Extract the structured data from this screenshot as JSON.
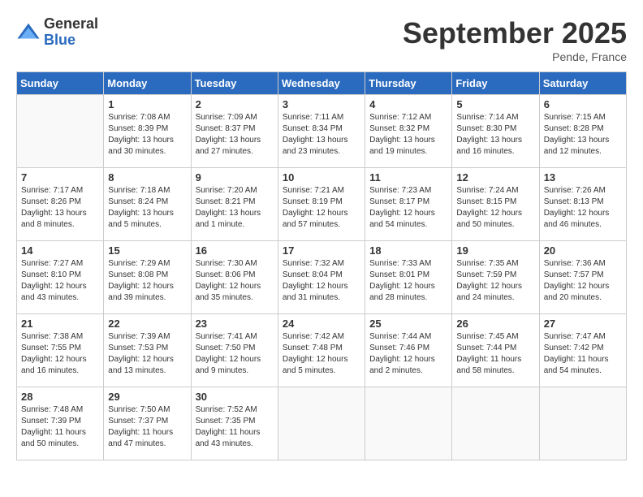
{
  "logo": {
    "general": "General",
    "blue": "Blue"
  },
  "title": "September 2025",
  "location": "Pende, France",
  "days_of_week": [
    "Sunday",
    "Monday",
    "Tuesday",
    "Wednesday",
    "Thursday",
    "Friday",
    "Saturday"
  ],
  "weeks": [
    [
      {
        "day": "",
        "info": ""
      },
      {
        "day": "1",
        "info": "Sunrise: 7:08 AM\nSunset: 8:39 PM\nDaylight: 13 hours\nand 30 minutes."
      },
      {
        "day": "2",
        "info": "Sunrise: 7:09 AM\nSunset: 8:37 PM\nDaylight: 13 hours\nand 27 minutes."
      },
      {
        "day": "3",
        "info": "Sunrise: 7:11 AM\nSunset: 8:34 PM\nDaylight: 13 hours\nand 23 minutes."
      },
      {
        "day": "4",
        "info": "Sunrise: 7:12 AM\nSunset: 8:32 PM\nDaylight: 13 hours\nand 19 minutes."
      },
      {
        "day": "5",
        "info": "Sunrise: 7:14 AM\nSunset: 8:30 PM\nDaylight: 13 hours\nand 16 minutes."
      },
      {
        "day": "6",
        "info": "Sunrise: 7:15 AM\nSunset: 8:28 PM\nDaylight: 13 hours\nand 12 minutes."
      }
    ],
    [
      {
        "day": "7",
        "info": "Sunrise: 7:17 AM\nSunset: 8:26 PM\nDaylight: 13 hours\nand 8 minutes."
      },
      {
        "day": "8",
        "info": "Sunrise: 7:18 AM\nSunset: 8:24 PM\nDaylight: 13 hours\nand 5 minutes."
      },
      {
        "day": "9",
        "info": "Sunrise: 7:20 AM\nSunset: 8:21 PM\nDaylight: 13 hours\nand 1 minute."
      },
      {
        "day": "10",
        "info": "Sunrise: 7:21 AM\nSunset: 8:19 PM\nDaylight: 12 hours\nand 57 minutes."
      },
      {
        "day": "11",
        "info": "Sunrise: 7:23 AM\nSunset: 8:17 PM\nDaylight: 12 hours\nand 54 minutes."
      },
      {
        "day": "12",
        "info": "Sunrise: 7:24 AM\nSunset: 8:15 PM\nDaylight: 12 hours\nand 50 minutes."
      },
      {
        "day": "13",
        "info": "Sunrise: 7:26 AM\nSunset: 8:13 PM\nDaylight: 12 hours\nand 46 minutes."
      }
    ],
    [
      {
        "day": "14",
        "info": "Sunrise: 7:27 AM\nSunset: 8:10 PM\nDaylight: 12 hours\nand 43 minutes."
      },
      {
        "day": "15",
        "info": "Sunrise: 7:29 AM\nSunset: 8:08 PM\nDaylight: 12 hours\nand 39 minutes."
      },
      {
        "day": "16",
        "info": "Sunrise: 7:30 AM\nSunset: 8:06 PM\nDaylight: 12 hours\nand 35 minutes."
      },
      {
        "day": "17",
        "info": "Sunrise: 7:32 AM\nSunset: 8:04 PM\nDaylight: 12 hours\nand 31 minutes."
      },
      {
        "day": "18",
        "info": "Sunrise: 7:33 AM\nSunset: 8:01 PM\nDaylight: 12 hours\nand 28 minutes."
      },
      {
        "day": "19",
        "info": "Sunrise: 7:35 AM\nSunset: 7:59 PM\nDaylight: 12 hours\nand 24 minutes."
      },
      {
        "day": "20",
        "info": "Sunrise: 7:36 AM\nSunset: 7:57 PM\nDaylight: 12 hours\nand 20 minutes."
      }
    ],
    [
      {
        "day": "21",
        "info": "Sunrise: 7:38 AM\nSunset: 7:55 PM\nDaylight: 12 hours\nand 16 minutes."
      },
      {
        "day": "22",
        "info": "Sunrise: 7:39 AM\nSunset: 7:53 PM\nDaylight: 12 hours\nand 13 minutes."
      },
      {
        "day": "23",
        "info": "Sunrise: 7:41 AM\nSunset: 7:50 PM\nDaylight: 12 hours\nand 9 minutes."
      },
      {
        "day": "24",
        "info": "Sunrise: 7:42 AM\nSunset: 7:48 PM\nDaylight: 12 hours\nand 5 minutes."
      },
      {
        "day": "25",
        "info": "Sunrise: 7:44 AM\nSunset: 7:46 PM\nDaylight: 12 hours\nand 2 minutes."
      },
      {
        "day": "26",
        "info": "Sunrise: 7:45 AM\nSunset: 7:44 PM\nDaylight: 11 hours\nand 58 minutes."
      },
      {
        "day": "27",
        "info": "Sunrise: 7:47 AM\nSunset: 7:42 PM\nDaylight: 11 hours\nand 54 minutes."
      }
    ],
    [
      {
        "day": "28",
        "info": "Sunrise: 7:48 AM\nSunset: 7:39 PM\nDaylight: 11 hours\nand 50 minutes."
      },
      {
        "day": "29",
        "info": "Sunrise: 7:50 AM\nSunset: 7:37 PM\nDaylight: 11 hours\nand 47 minutes."
      },
      {
        "day": "30",
        "info": "Sunrise: 7:52 AM\nSunset: 7:35 PM\nDaylight: 11 hours\nand 43 minutes."
      },
      {
        "day": "",
        "info": ""
      },
      {
        "day": "",
        "info": ""
      },
      {
        "day": "",
        "info": ""
      },
      {
        "day": "",
        "info": ""
      }
    ]
  ]
}
